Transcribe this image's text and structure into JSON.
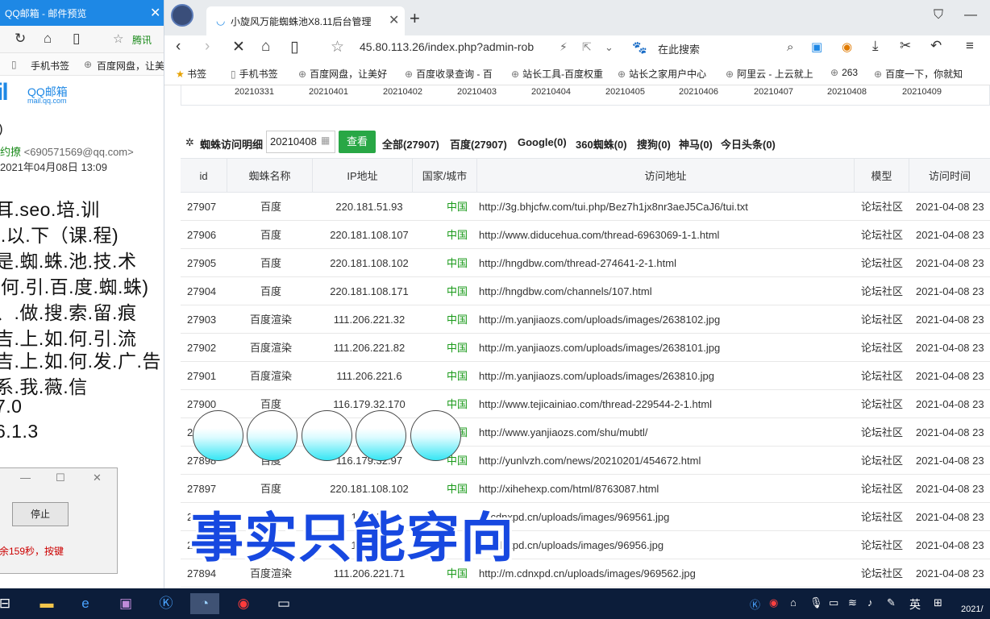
{
  "left_window": {
    "title": "QQ邮箱 - 邮件预览",
    "nav_partner": "腾讯",
    "bookmarks": [
      "手机书签",
      "百度网盘，让美"
    ],
    "logo_big": "il",
    "logo_cn": "QQ邮箱",
    "logo_en": "mail.qq.com",
    "mail_subject_tail": ")",
    "sender_name": "约撩",
    "sender_email": "<690571569@qq.com>",
    "sent_time": "2021年04月08日 13:09",
    "body_lines": [
      "耳.seo.培.训",
      "I.以.下（课.程)",
      "是.蜘.蛛.池.技.术",
      ".何.引.百.度.蜘.蛛)",
      "、.做.搜.索.留.痕",
      "吉.上.如.何.引.流",
      "吉.上.如.何.发.广.告",
      "系.我.薇.信",
      "7.0",
      "6.1.3"
    ],
    "dialog_stop": "停止",
    "dialog_msg": "余159秒，按键"
  },
  "browser": {
    "tab_title": "小旋风万能蜘蛛池X8.11后台管理",
    "url": "45.80.113.26/index.php?admin-rob",
    "search_placeholder": "在此搜索",
    "bookmarks": [
      {
        "label": "书签"
      },
      {
        "label": "手机书签"
      },
      {
        "label": "百度网盘，让美好"
      },
      {
        "label": "百度收录查询 - 百"
      },
      {
        "label": "站长工具-百度权重"
      },
      {
        "label": "站长之家用户中心"
      },
      {
        "label": "阿里云 - 上云就上"
      },
      {
        "label": "263"
      },
      {
        "label": "百度一下，你就知"
      }
    ]
  },
  "page": {
    "dates": [
      "20210331",
      "20210401",
      "20210402",
      "20210403",
      "20210404",
      "20210405",
      "20210406",
      "20210407",
      "20210408",
      "20210409"
    ],
    "filter_title": "蜘蛛访问明细",
    "filter_date": "20210408",
    "view_button": "查看",
    "stats": [
      "全部(27907)",
      "百度(27907)",
      "Google(0)",
      "360蜘蛛(0)",
      "搜狗(0)",
      "神马(0)",
      "今日头条(0)"
    ],
    "headers": [
      "id",
      "蜘蛛名称",
      "IP地址",
      "国家/城市",
      "访问地址",
      "模型",
      "访问时间"
    ],
    "rows": [
      {
        "id": "27907",
        "spider": "百度",
        "ip": "220.181.51.93",
        "country": "中国",
        "url": "http://3g.bhjcfw.com/tui.php/Bez7h1jx8nr3aeJ5CaJ6/tui.txt",
        "model": "论坛社区",
        "time": "2021-04-08 23"
      },
      {
        "id": "27906",
        "spider": "百度",
        "ip": "220.181.108.107",
        "country": "中国",
        "url": "http://www.diducehua.com/thread-6963069-1-1.html",
        "model": "论坛社区",
        "time": "2021-04-08 23"
      },
      {
        "id": "27905",
        "spider": "百度",
        "ip": "220.181.108.102",
        "country": "中国",
        "url": "http://hngdbw.com/thread-274641-2-1.html",
        "model": "论坛社区",
        "time": "2021-04-08 23"
      },
      {
        "id": "27904",
        "spider": "百度",
        "ip": "220.181.108.171",
        "country": "中国",
        "url": "http://hngdbw.com/channels/107.html",
        "model": "论坛社区",
        "time": "2021-04-08 23"
      },
      {
        "id": "27903",
        "spider": "百度渲染",
        "ip": "111.206.221.32",
        "country": "中国",
        "url": "http://m.yanjiaozs.com/uploads/images/2638102.jpg",
        "model": "论坛社区",
        "time": "2021-04-08 23"
      },
      {
        "id": "27902",
        "spider": "百度渲染",
        "ip": "111.206.221.82",
        "country": "中国",
        "url": "http://m.yanjiaozs.com/uploads/images/2638101.jpg",
        "model": "论坛社区",
        "time": "2021-04-08 23"
      },
      {
        "id": "27901",
        "spider": "百度渲染",
        "ip": "111.206.221.6",
        "country": "中国",
        "url": "http://m.yanjiaozs.com/uploads/images/263810.jpg",
        "model": "论坛社区",
        "time": "2021-04-08 23"
      },
      {
        "id": "27900",
        "spider": "百度",
        "ip": "116.179.32.170",
        "country": "中国",
        "url": "http://www.tejicainiao.com/thread-229544-2-1.html",
        "model": "论坛社区",
        "time": "2021-04-08 23"
      },
      {
        "id": "2",
        "spider": "",
        "ip": "",
        "country": "中国",
        "url": "http://www.yanjiaozs.com/shu/mubtl/",
        "model": "论坛社区",
        "time": "2021-04-08 23"
      },
      {
        "id": "27898",
        "spider": "百度",
        "ip": "116.179.32.97",
        "country": "中国",
        "url": "http://yunlvzh.com/news/20210201/454672.html",
        "model": "论坛社区",
        "time": "2021-04-08 23"
      },
      {
        "id": "27897",
        "spider": "百度",
        "ip": "220.181.108.102",
        "country": "中国",
        "url": "http://xihehexp.com/html/8763087.html",
        "model": "论坛社区",
        "time": "2021-04-08 23"
      },
      {
        "id": "27",
        "spider": "",
        "ip": "111.206",
        "country": "",
        "url": "m.cdnxpd.cn/uploads/images/969561.jpg",
        "model": "论坛社区",
        "time": "2021-04-08 23"
      },
      {
        "id": "278",
        "spider": "",
        "ip": "111.206",
        "country": "",
        "url": "m.cdnxpd.cn/uploads/images/96956.jpg",
        "model": "论坛社区",
        "time": "2021-04-08 23"
      },
      {
        "id": "27894",
        "spider": "百度渲染",
        "ip": "111.206.221.71",
        "country": "中国",
        "url": "http://m.cdnxpd.cn/uploads/images/969562.jpg",
        "model": "论坛社区",
        "time": "2021-04-08 23"
      }
    ]
  },
  "overlay": {
    "caption": "事实只能穿向"
  },
  "taskbar": {
    "ime": "英",
    "clock": "2021/"
  },
  "colors": {
    "accent": "#1e88e5",
    "button_green": "#28a745",
    "country_green": "#1a9a1a",
    "caption_blue": "#1748e0",
    "taskbar": "#0c1d3a"
  }
}
